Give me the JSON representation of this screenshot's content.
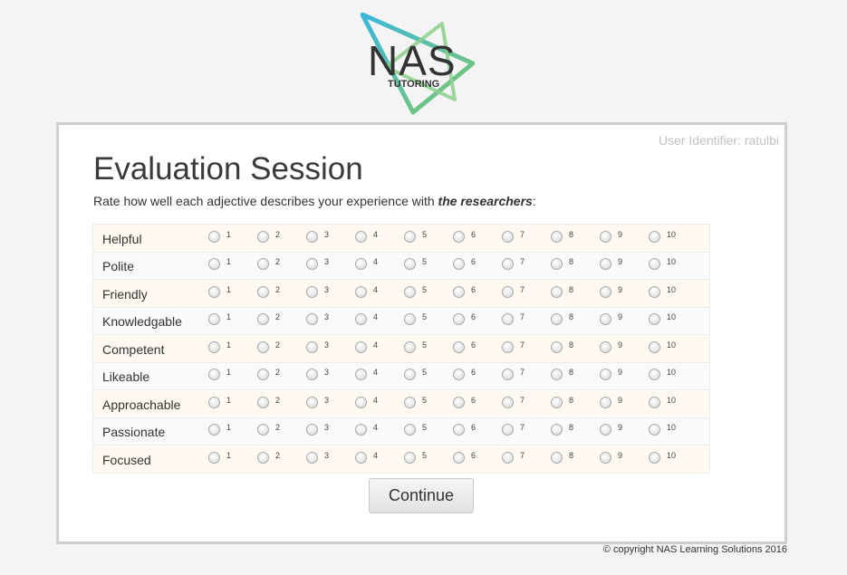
{
  "logo": {
    "brand": "NAS",
    "tagline": "TUTORING"
  },
  "user_identifier": "User Identifier: ratulbi",
  "page_title": "Evaluation Session",
  "instruction": {
    "prefix": "Rate how well each adjective describes your experience with ",
    "emphasis": "the researchers",
    "suffix": ":"
  },
  "scale": [
    "1",
    "2",
    "3",
    "4",
    "5",
    "6",
    "7",
    "8",
    "9",
    "10"
  ],
  "rows": [
    {
      "label": "Helpful"
    },
    {
      "label": "Polite"
    },
    {
      "label": "Friendly"
    },
    {
      "label": "Knowledgable"
    },
    {
      "label": "Competent"
    },
    {
      "label": "Likeable"
    },
    {
      "label": "Approachable"
    },
    {
      "label": "Passionate"
    },
    {
      "label": "Focused"
    }
  ],
  "continue_label": "Continue",
  "copyright": "© copyright NAS Learning Solutions 2016",
  "colors": {
    "logo_cyan": "#3cb8dc",
    "logo_green": "#7ec86a",
    "logo_text": "#333333"
  }
}
